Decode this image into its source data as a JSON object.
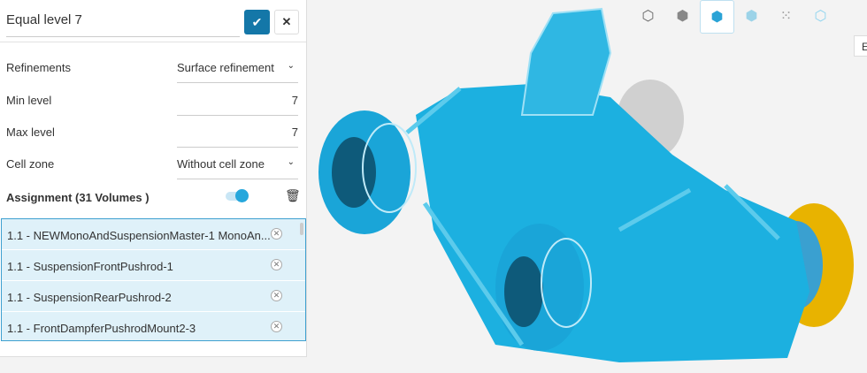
{
  "panel": {
    "title": "Equal level 7",
    "confirm_icon": "✔",
    "close_icon": "✕",
    "fields": [
      {
        "label": "Refinements",
        "value": "Surface refinement"
      },
      {
        "label": "Min level",
        "value": "7"
      },
      {
        "label": "Max level",
        "value": "7"
      },
      {
        "label": "Cell zone",
        "value": "Without cell zone"
      }
    ],
    "assignment_label": "Assignment (31 Volumes )",
    "items": [
      "1.1 - NEWMonoAndSuspensionMaster-1 MonoAn...",
      "1.1 - SuspensionFrontPushrod-1",
      "1.1 - SuspensionRearPushrod-2",
      "1.1 - FrontDampferPushrodMount2-3"
    ]
  },
  "viewer": {
    "toolbar": [
      "wireframe-view",
      "solid-view",
      "solid-edges-view",
      "transparent-view",
      "points-view",
      "transparent-edges-view"
    ],
    "tooltip": "E",
    "model_color": "#1cb0e0",
    "tire_color": "#f1b400"
  }
}
